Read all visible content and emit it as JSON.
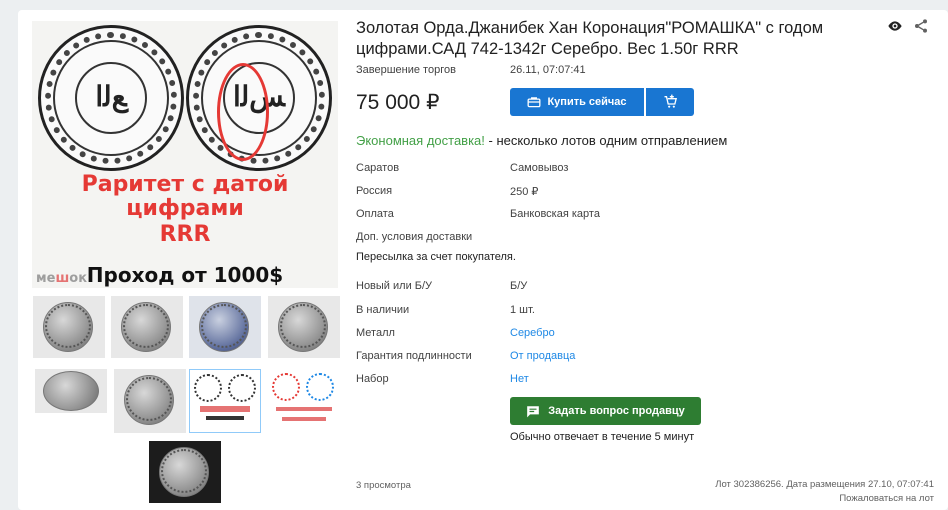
{
  "title": "Золотая Орда.Джанибек Хан Коронация\"РОМАШКА\" с годом цифрами.САД 742-1342г Серебро. Вес 1.50г RRR",
  "auction_end": {
    "label": "Завершение торгов",
    "value": "26.11, 07:07:41"
  },
  "price": "75 000 ₽",
  "buy_button": "Купить сейчас",
  "shipping_note": {
    "highlight": "Экономная доставка!",
    "rest": " - несколько лотов одним отправлением"
  },
  "delivery": [
    {
      "label": "Саратов",
      "value": "Самовывоз"
    },
    {
      "label": "Россия",
      "value": "250 ₽"
    },
    {
      "label": "Оплата",
      "value": "Банковская карта"
    },
    {
      "label": "Доп. условия доставки",
      "value": ""
    }
  ],
  "delivery_note": "Пересылка за счет покупателя.",
  "specs": [
    {
      "label": "Новый или Б/У",
      "value": "Б/У"
    },
    {
      "label": "В наличии",
      "value": "1 шт."
    },
    {
      "label": "Металл",
      "value": "Серебро"
    },
    {
      "label": "Гарантия подлинности",
      "value": "От продавца"
    },
    {
      "label": "Набор",
      "value": "Нет"
    }
  ],
  "ask_button": "Задать вопрос продавцу",
  "reply_note": "Обычно отвечает в течение 5 минут",
  "views": "3 просмотра",
  "lot_info": "Лот 302386256. Дата размещения 27.10, 07:07:41",
  "report": "Пожаловаться на лот",
  "photo": {
    "line1": "Раритет с датой",
    "line2": "цифрами",
    "line3": "RRR",
    "line4": "Проход от 1000$",
    "watermark_a": "ме",
    "watermark_b": "ш",
    "watermark_c": "ок"
  },
  "colors": {
    "accent": "#1976d2",
    "green": "#2e7d32",
    "link": "#1e88e5",
    "red": "#e53935"
  }
}
